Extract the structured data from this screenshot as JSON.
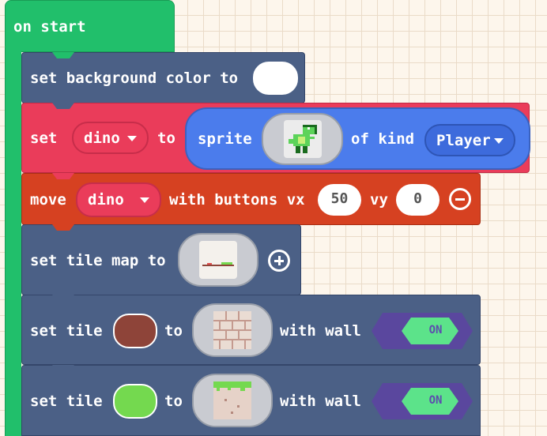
{
  "hat": {
    "label": "on start"
  },
  "background": {
    "label": "set background color to",
    "color": "#ffffff"
  },
  "sprite_block": {
    "set_label": "set",
    "variable": "dino",
    "to_label": "to",
    "sprite_label": "sprite",
    "of_kind_label": "of kind",
    "kind": "Player"
  },
  "move_block": {
    "label": "move",
    "variable": "dino",
    "buttons_label": "with buttons vx",
    "vx": "50",
    "vy_label": "vy",
    "vy": "0"
  },
  "tilemap_block": {
    "label": "set tile map to"
  },
  "tile_block_1": {
    "set_label": "set tile",
    "color": "#8e4439",
    "to_label": "to",
    "wall_label": "with wall",
    "toggle": "ON"
  },
  "tile_block_2": {
    "set_label": "set tile",
    "color": "#74d94f",
    "to_label": "to",
    "wall_label": "with wall",
    "toggle": "ON"
  },
  "colors": {
    "events": "#21bf6b",
    "scene": "#4b6086",
    "sprites": "#ea3c5a",
    "controller": "#d64121",
    "sprite_pill": "#4b7cec",
    "toggle_on": "#5ce38a",
    "toggle_bg": "#5a479e"
  }
}
